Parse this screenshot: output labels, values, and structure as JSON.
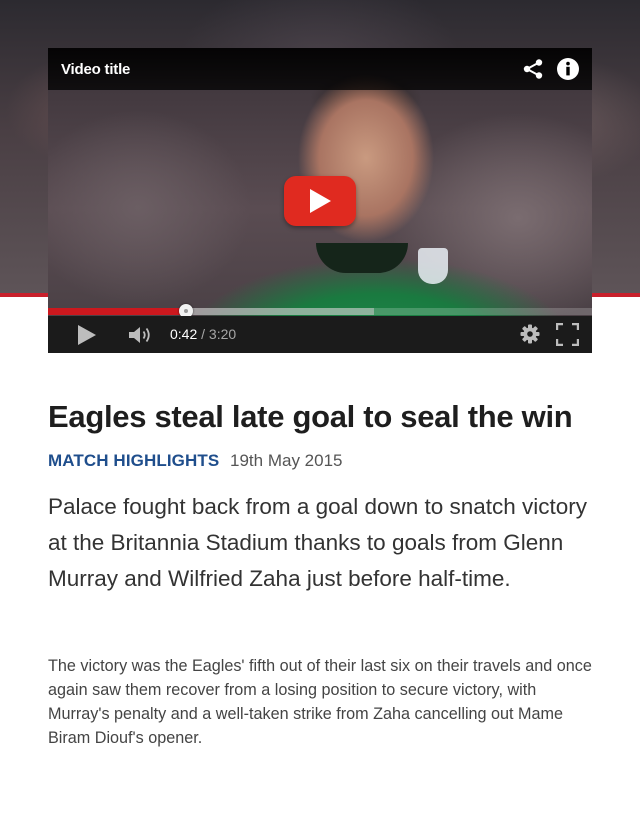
{
  "video": {
    "title": "Video title",
    "play_button_label": "Play",
    "current_time": "0:42",
    "separator": "/",
    "duration": "3:20",
    "progress_fraction": 0.253,
    "buffered_fraction": 0.6,
    "icons": [
      "share-icon",
      "info-icon",
      "play-icon",
      "volume-icon",
      "gear-icon",
      "fullscreen-icon"
    ],
    "colors": {
      "progress": "#cc181e",
      "play_overlay": "#e02a20",
      "accent_stripe": "#c8202c"
    }
  },
  "article": {
    "headline": "Eagles steal late goal to seal the win",
    "category": "MATCH HIGHLIGHTS",
    "date": "19th May 2015",
    "lead": "Palace fought back from a goal down to snatch victory at the Britannia Stadium thanks to goals from Glenn Murray and Wilfried Zaha just before half-time.",
    "body": "The victory was the Eagles' fifth out of their last six on their travels and once again saw them recover from a losing position to secure victory, with Murray's penalty and a well-taken strike from Zaha cancelling out Mame Biram Diouf's opener.",
    "colors": {
      "category": "#1f4e8c",
      "headline": "#1e1e1e"
    }
  }
}
